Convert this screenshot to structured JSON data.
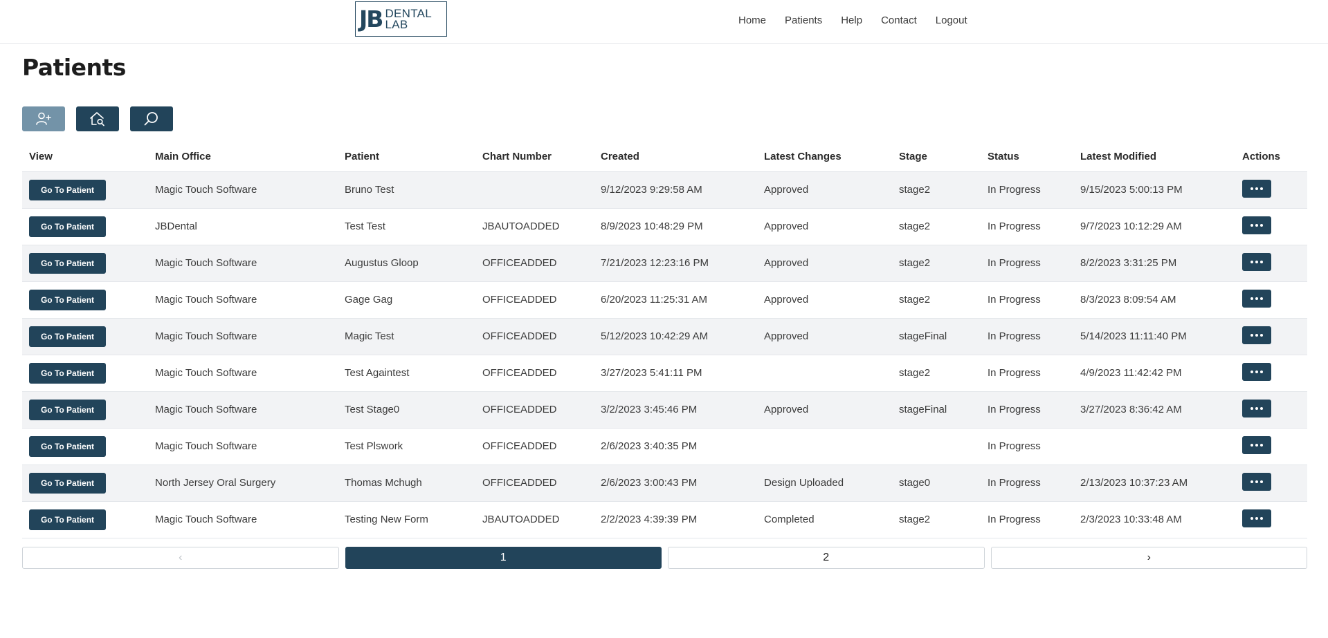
{
  "brand": {
    "logo_main": "JB",
    "logo_line1": "DENTAL",
    "logo_line2": "LAB"
  },
  "nav": [
    "Home",
    "Patients",
    "Help",
    "Contact",
    "Logout"
  ],
  "page_title": "Patients",
  "table": {
    "headers": [
      "View",
      "Main Office",
      "Patient",
      "Chart Number",
      "Created",
      "Latest Changes",
      "Stage",
      "Status",
      "Latest Modified",
      "Actions"
    ],
    "goto_label": "Go To Patient",
    "rows": [
      [
        "Magic Touch Software",
        "Bruno Test",
        "",
        "9/12/2023 9:29:58 AM",
        "Approved",
        "stage2",
        "In Progress",
        "9/15/2023 5:00:13 PM"
      ],
      [
        "JBDental",
        "Test Test",
        "JBAUTOADDED",
        "8/9/2023 10:48:29 PM",
        "Approved",
        "stage2",
        "In Progress",
        "9/7/2023 10:12:29 AM"
      ],
      [
        "Magic Touch Software",
        "Augustus Gloop",
        "OFFICEADDED",
        "7/21/2023 12:23:16 PM",
        "Approved",
        "stage2",
        "In Progress",
        "8/2/2023 3:31:25 PM"
      ],
      [
        "Magic Touch Software",
        "Gage Gag",
        "OFFICEADDED",
        "6/20/2023 11:25:31 AM",
        "Approved",
        "stage2",
        "In Progress",
        "8/3/2023 8:09:54 AM"
      ],
      [
        "Magic Touch Software",
        "Magic Test",
        "OFFICEADDED",
        "5/12/2023 10:42:29 AM",
        "Approved",
        "stageFinal",
        "In Progress",
        "5/14/2023 11:11:40 PM"
      ],
      [
        "Magic Touch Software",
        "Test Againtest",
        "OFFICEADDED",
        "3/27/2023 5:41:11 PM",
        "",
        "stage2",
        "In Progress",
        "4/9/2023 11:42:42 PM"
      ],
      [
        "Magic Touch Software",
        "Test Stage0",
        "OFFICEADDED",
        "3/2/2023 3:45:46 PM",
        "Approved",
        "stageFinal",
        "In Progress",
        "3/27/2023 8:36:42 AM"
      ],
      [
        "Magic Touch Software",
        "Test Plswork",
        "OFFICEADDED",
        "2/6/2023 3:40:35 PM",
        "",
        "",
        "In Progress",
        ""
      ],
      [
        "North Jersey Oral Surgery",
        "Thomas Mchugh",
        "OFFICEADDED",
        "2/6/2023 3:00:43 PM",
        "Design Uploaded",
        "stage0",
        "In Progress",
        "2/13/2023 10:37:23 AM"
      ],
      [
        "Magic Touch Software",
        "Testing New Form",
        "JBAUTOADDED",
        "2/2/2023 4:39:39 PM",
        "Completed",
        "stage2",
        "In Progress",
        "2/3/2023 10:33:48 AM"
      ]
    ]
  },
  "pagination": {
    "prev": "‹",
    "pages": [
      "1",
      "2"
    ],
    "current": "1",
    "next": "›"
  },
  "colors": {
    "primary": "#22445a",
    "toolbar_light": "#7393a8",
    "row_stripe": "#f2f3f5"
  }
}
